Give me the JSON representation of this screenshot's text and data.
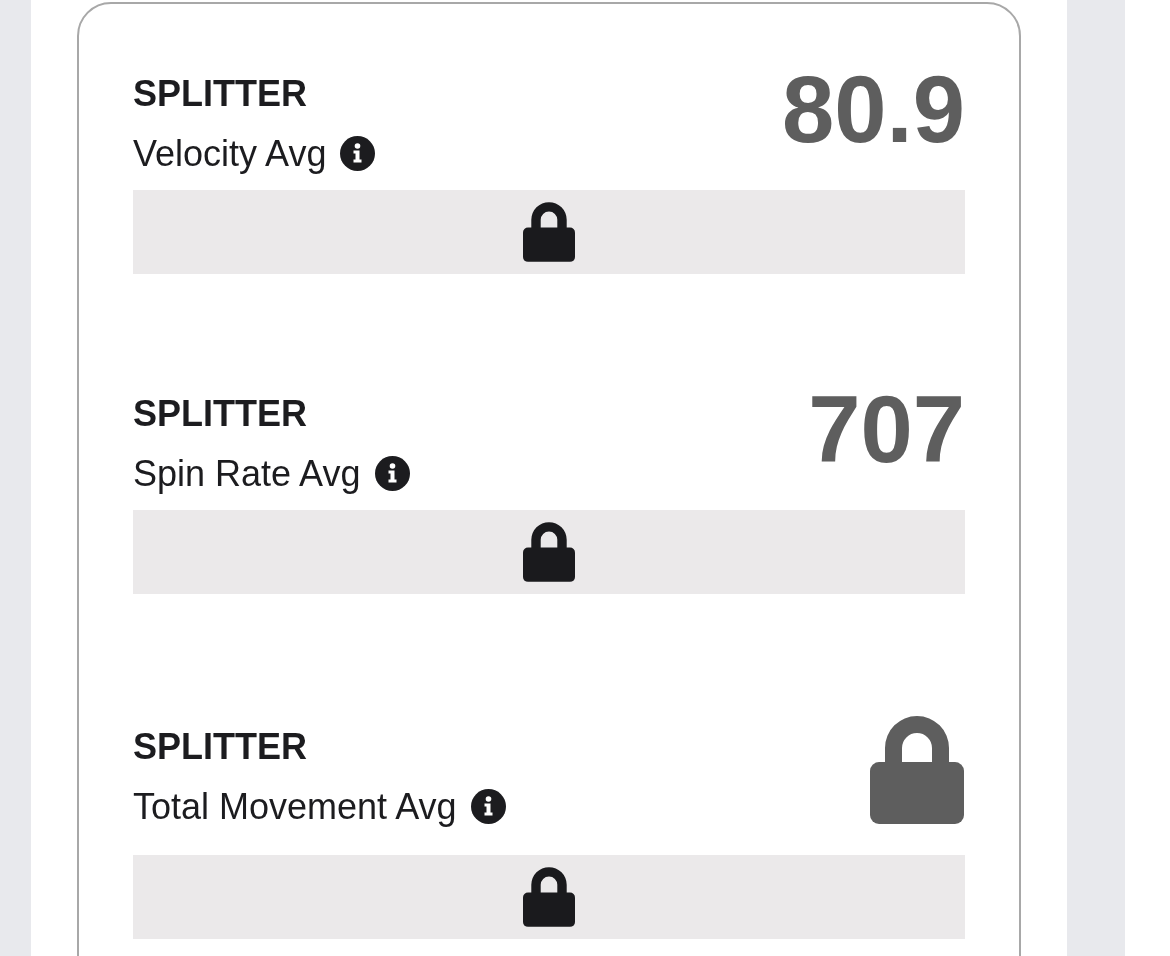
{
  "metrics": [
    {
      "pitch": "SPLITTER",
      "label": "Velocity Avg",
      "kind": "value",
      "value": "80.9",
      "bar": {
        "locked": true
      }
    },
    {
      "pitch": "SPLITTER",
      "label": "Spin Rate Avg",
      "kind": "value",
      "value": "707",
      "bar": {
        "locked": true
      }
    },
    {
      "pitch": "SPLITTER",
      "label": "Total Movement Avg",
      "kind": "locked",
      "bar": {
        "locked": true
      }
    }
  ]
}
